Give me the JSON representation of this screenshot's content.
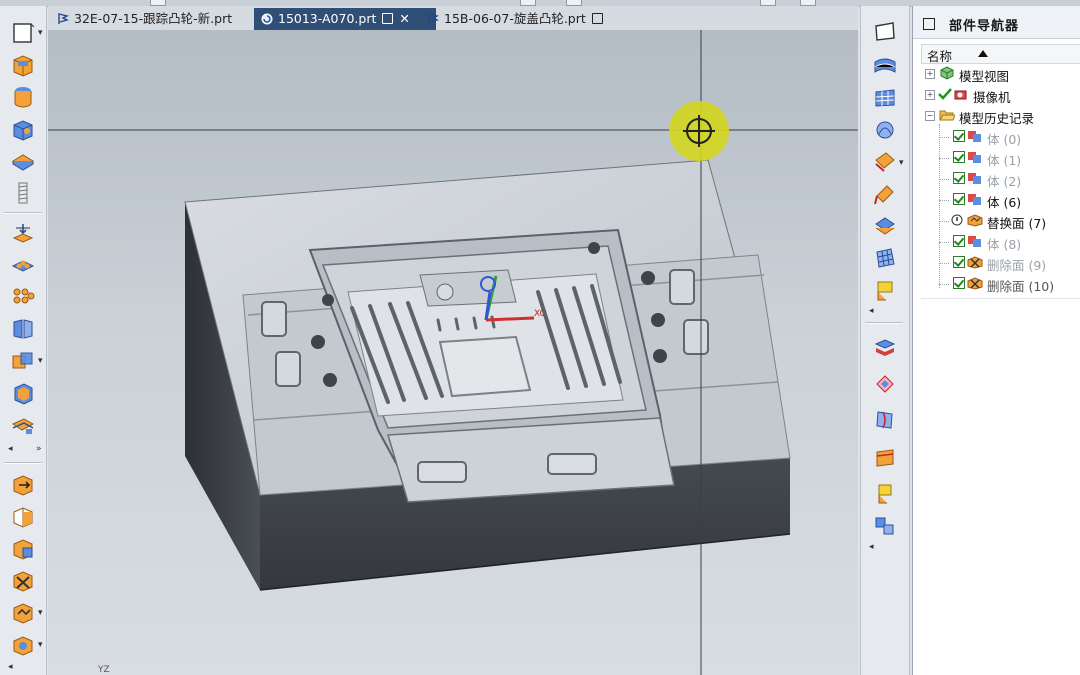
{
  "tabs": [
    {
      "label": "32E-07-15-跟踪凸轮-新.prt",
      "active": false
    },
    {
      "label": "15013-A070.prt",
      "active": true
    },
    {
      "label": "15B-06-07-旋盖凸轮.prt",
      "active": false
    }
  ],
  "navigator": {
    "title": "部件导航器",
    "column_header": "名称",
    "items": [
      {
        "label": "模型视图",
        "icon": "model-views-icon",
        "expander": "+"
      },
      {
        "label": "摄像机",
        "icon": "camera-icon",
        "expander": "+"
      },
      {
        "label": "模型历史记录",
        "icon": "folder-open-icon",
        "expander": "−"
      },
      {
        "label": "体 (0)",
        "icon": "body-feature-icon",
        "state": "inactive"
      },
      {
        "label": "体 (1)",
        "icon": "body-feature-icon",
        "state": "inactive"
      },
      {
        "label": "体 (2)",
        "icon": "body-feature-icon",
        "state": "inactive"
      },
      {
        "label": "体 (6)",
        "icon": "body-feature-icon",
        "state": "active"
      },
      {
        "label": "替换面 (7)",
        "icon": "replace-face-icon",
        "state": "current"
      },
      {
        "label": "体 (8)",
        "icon": "body-feature-icon",
        "state": "inactive"
      },
      {
        "label": "删除面 (9)",
        "icon": "delete-face-icon",
        "state": "inactive"
      },
      {
        "label": "删除面 (10)",
        "icon": "delete-face-icon",
        "state": "active"
      }
    ]
  },
  "viewport": {
    "triad_label": "XC",
    "corner_label": "YZ"
  },
  "colors": {
    "active_tab": "#2f4f76",
    "viewport_top": "#b4bcc4",
    "viewport_bottom": "#d8dde2",
    "model_face": "#c8ced4",
    "model_dark": "#3f4348",
    "cursor_highlight": "#d4d61e"
  }
}
